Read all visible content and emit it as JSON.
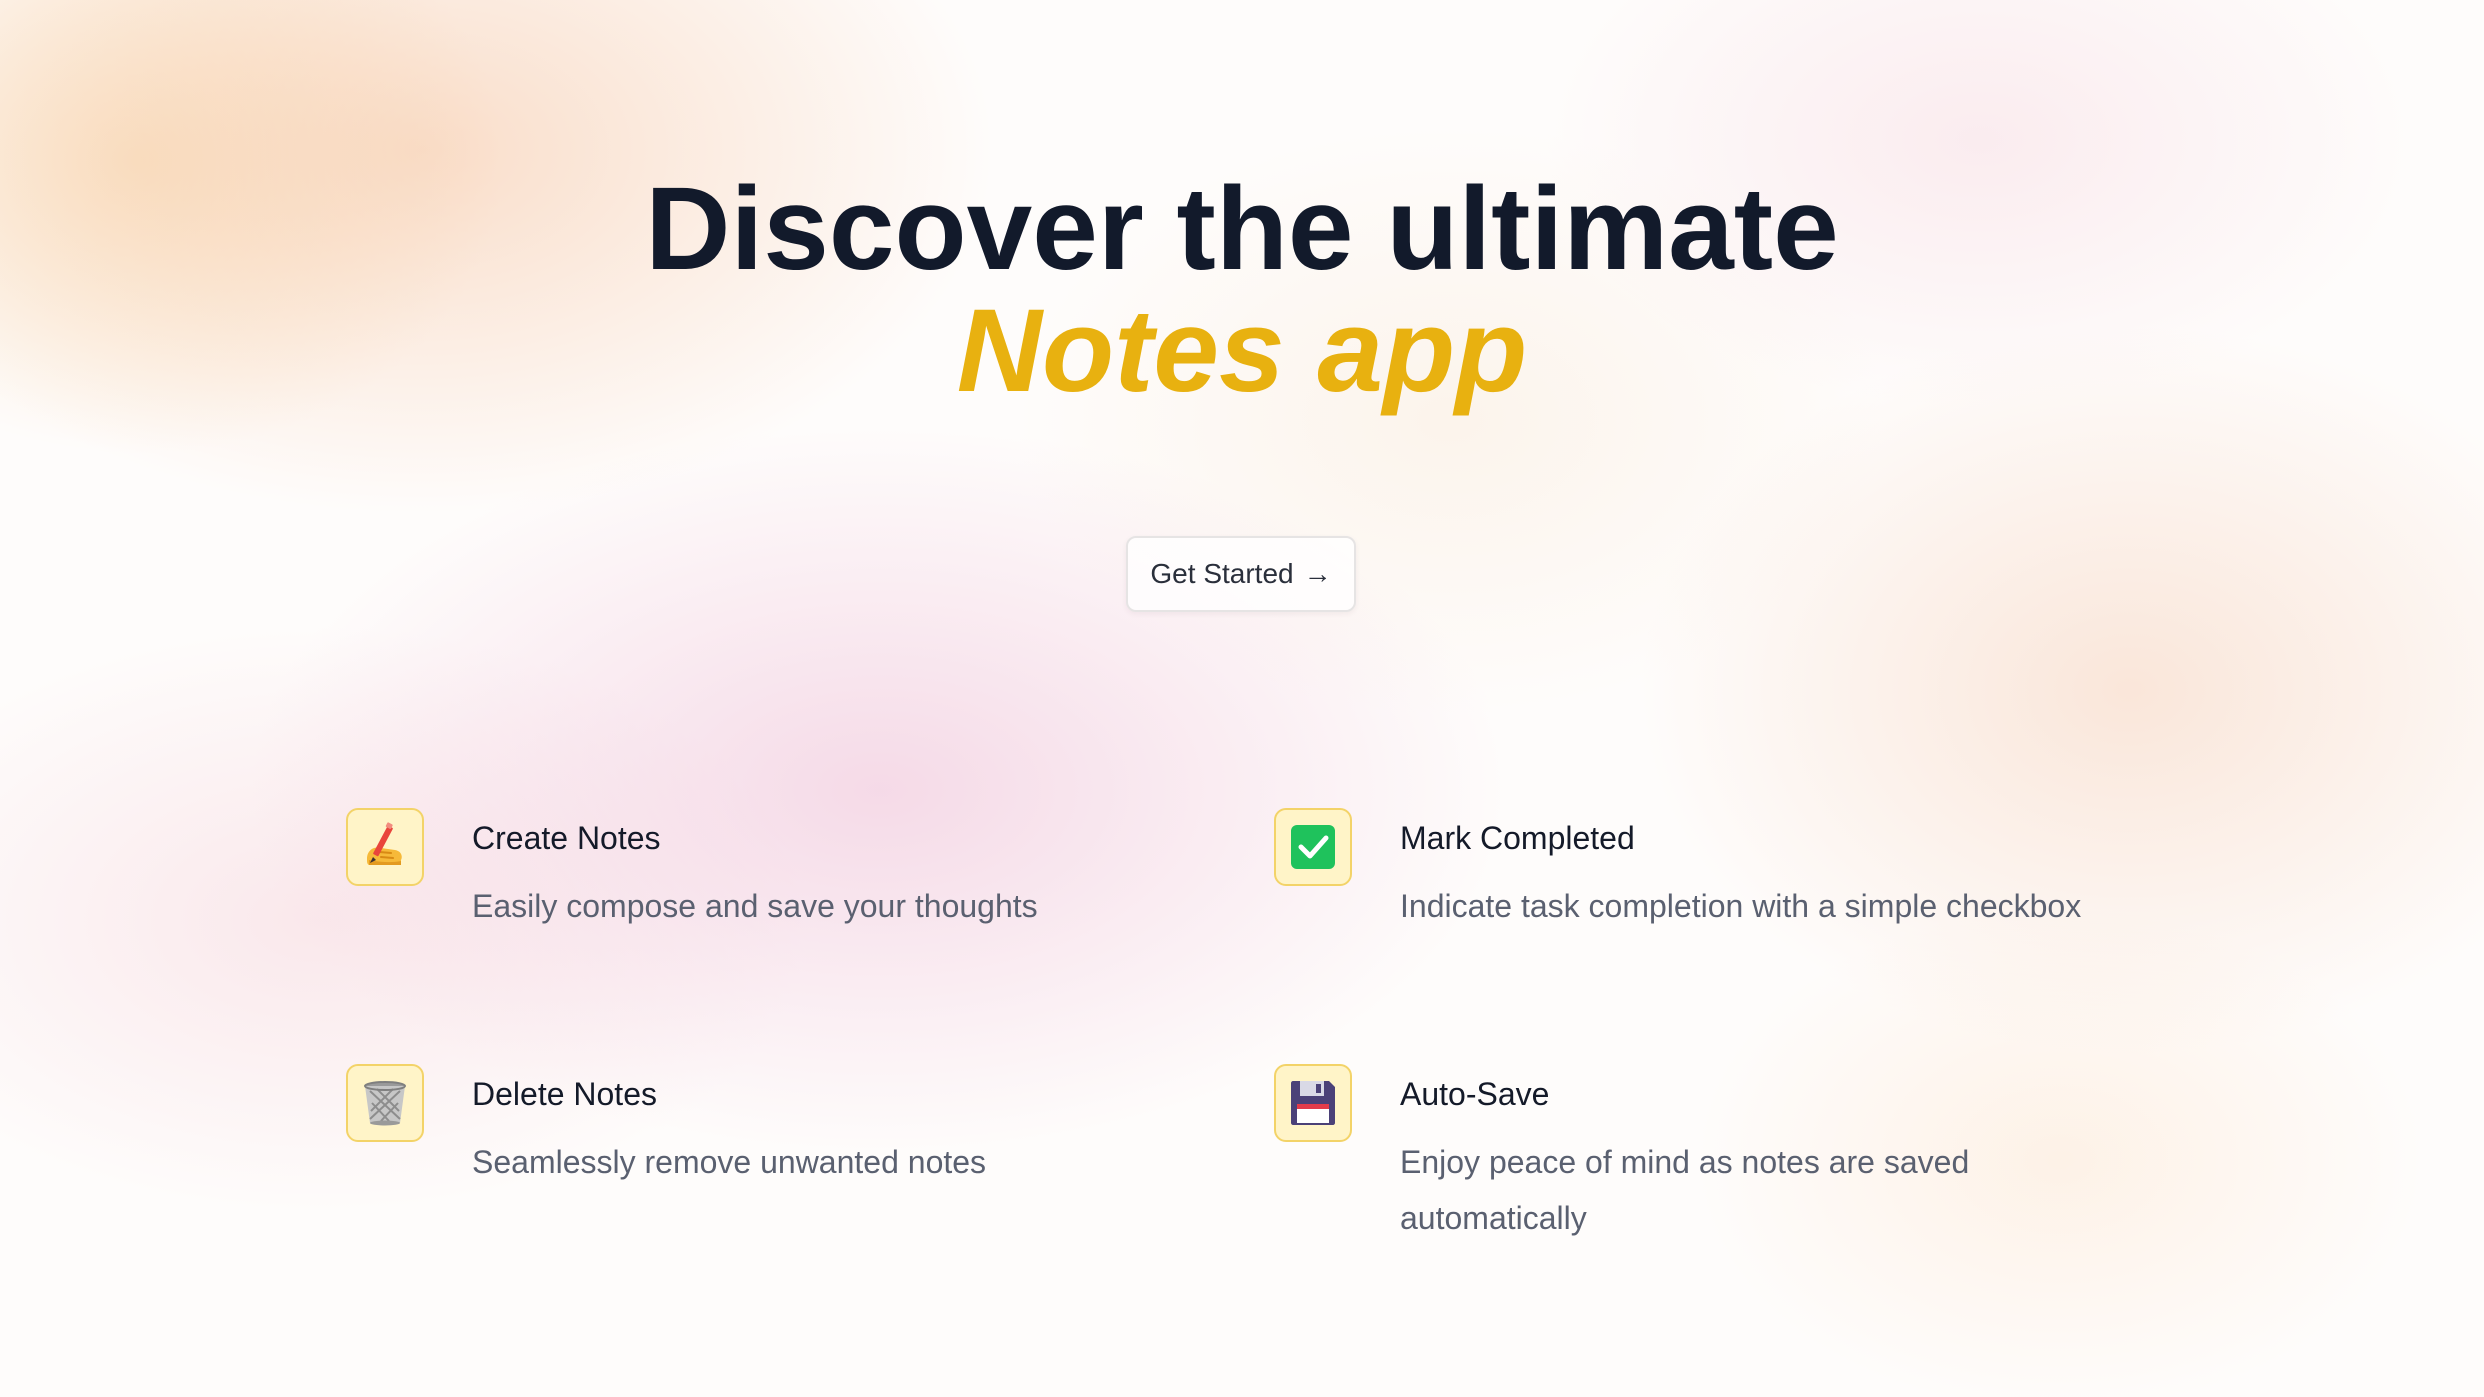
{
  "hero": {
    "title_line1": "Discover the ultimate",
    "title_line2": "Notes app",
    "cta_label": "Get Started",
    "cta_arrow": "→"
  },
  "features": [
    {
      "icon": "writing-hand-icon",
      "title": "Create Notes",
      "description": "Easily compose and save your thoughts"
    },
    {
      "icon": "check-mark-icon",
      "title": "Mark Completed",
      "description": "Indicate task completion with a simple checkbox"
    },
    {
      "icon": "wastebasket-icon",
      "title": "Delete Notes",
      "description": "Seamlessly remove unwanted notes"
    },
    {
      "icon": "floppy-disk-icon",
      "title": "Auto-Save",
      "description": "Enjoy peace of mind as notes are saved automatically"
    }
  ],
  "colors": {
    "title": "#121a2b",
    "accent": "#e8b110",
    "icon_border": "#f3d368",
    "icon_background": "#fff4c8",
    "check_green": "#1fc25c"
  }
}
